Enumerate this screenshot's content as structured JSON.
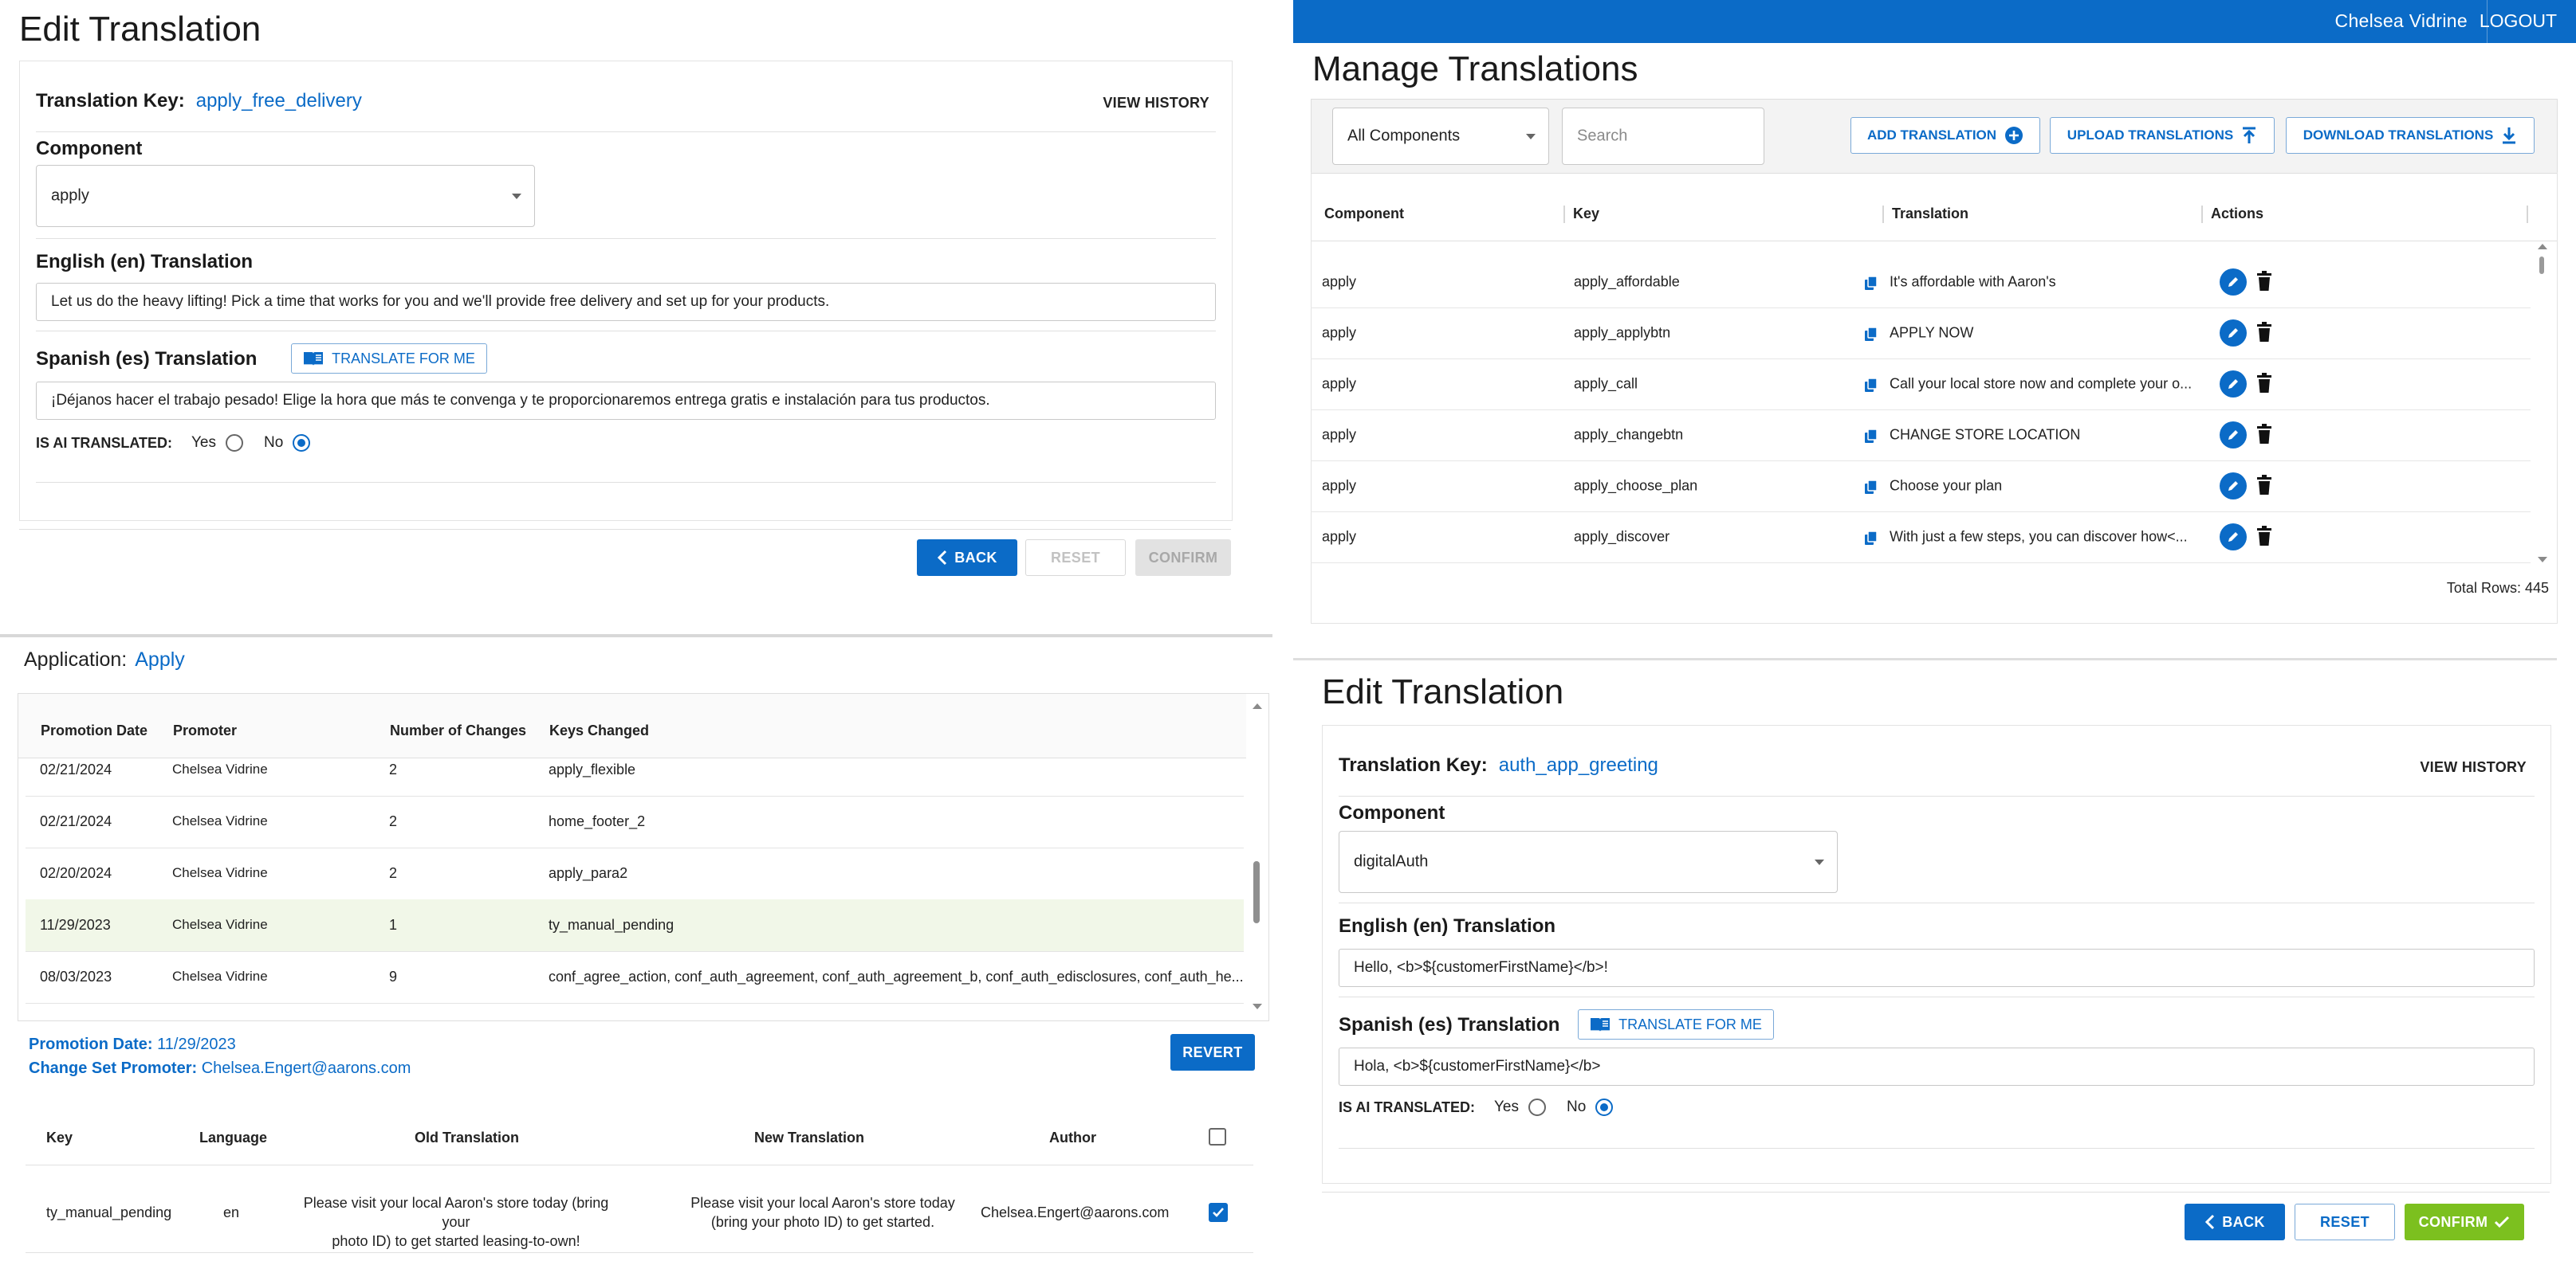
{
  "colors": {
    "accent": "#0b6bc7",
    "confirm_green": "#7cc01f",
    "highlight_row": "#f1f7e8"
  },
  "panel_a": {
    "title": "Edit Translation",
    "key_label": "Translation Key:",
    "key_value": "apply_free_delivery",
    "view_history": "VIEW HISTORY",
    "component_label": "Component",
    "component_value": "apply",
    "english_label": "English (en) Translation",
    "english_value": "Let us do the heavy lifting! Pick a time that works for you and we'll provide free delivery and set up for your products.",
    "spanish_label": "Spanish (es) Translation",
    "translate_btn": "TRANSLATE FOR ME",
    "spanish_value": "¡Déjanos hacer el trabajo pesado! Elige la hora que más te convenga y te proporcionaremos entrega gratis e instalación para tus productos.",
    "ai_label": "IS AI TRANSLATED:",
    "yes": "Yes",
    "no": "No",
    "back": "BACK",
    "reset": "RESET",
    "confirm": "CONFIRM"
  },
  "panel_b": {
    "user": "Chelsea Vidrine",
    "logout": "LOGOUT",
    "title": "Manage Translations",
    "component_filter": "All Components",
    "search_placeholder": "Search",
    "add_btn": "ADD TRANSLATION",
    "upload_btn": "UPLOAD TRANSLATIONS",
    "download_btn": "DOWNLOAD TRANSLATIONS",
    "columns": {
      "component": "Component",
      "key": "Key",
      "translation": "Translation",
      "actions": "Actions"
    },
    "rows": [
      {
        "component": "apply",
        "key": "apply_affordable",
        "translation": "It's affordable with Aaron's"
      },
      {
        "component": "apply",
        "key": "apply_applybtn",
        "translation": "APPLY NOW"
      },
      {
        "component": "apply",
        "key": "apply_call",
        "translation": "Call your local store now and complete your o..."
      },
      {
        "component": "apply",
        "key": "apply_changebtn",
        "translation": "CHANGE STORE LOCATION"
      },
      {
        "component": "apply",
        "key": "apply_choose_plan",
        "translation": "Choose your plan"
      },
      {
        "component": "apply",
        "key": "apply_discover",
        "translation": "With just a few steps, you can discover how<..."
      }
    ],
    "total_rows": "Total Rows: 445"
  },
  "panel_c": {
    "app_label": "Application:",
    "app_value": "Apply",
    "columns": {
      "date": "Promotion Date",
      "promoter": "Promoter",
      "changes": "Number of Changes",
      "keys": "Keys Changed"
    },
    "rows": [
      {
        "date": "02/21/2024",
        "promoter": "Chelsea Vidrine",
        "changes": "2",
        "keys": "apply_flexible"
      },
      {
        "date": "02/21/2024",
        "promoter": "Chelsea Vidrine",
        "changes": "2",
        "keys": "home_footer_2"
      },
      {
        "date": "02/20/2024",
        "promoter": "Chelsea Vidrine",
        "changes": "2",
        "keys": "apply_para2"
      },
      {
        "date": "11/29/2023",
        "promoter": "Chelsea Vidrine",
        "changes": "1",
        "keys": "ty_manual_pending"
      },
      {
        "date": "08/03/2023",
        "promoter": "Chelsea Vidrine",
        "changes": "9",
        "keys": "conf_agree_action, conf_auth_agreement, conf_auth_agreement_b, conf_auth_edisclosures, conf_auth_he..."
      }
    ],
    "detail": {
      "date_label": "Promotion Date:",
      "date_value": "11/29/2023",
      "promoter_label": "Change Set Promoter:",
      "promoter_value": "Chelsea.Engert@aarons.com",
      "revert": "REVERT",
      "columns": {
        "key": "Key",
        "language": "Language",
        "old": "Old Translation",
        "new": "New Translation",
        "author": "Author"
      },
      "row": {
        "key": "ty_manual_pending",
        "language": "en",
        "old_line1": "Please visit your local Aaron's store today (bring your",
        "old_line2": "photo ID) to get started leasing-to-own!",
        "new_line1": "Please visit your local Aaron's store today",
        "new_line2": "(bring your photo ID) to get started.",
        "author": "Chelsea.Engert@aarons.com"
      }
    }
  },
  "panel_d": {
    "title": "Edit Translation",
    "key_label": "Translation Key:",
    "key_value": "auth_app_greeting",
    "view_history": "VIEW HISTORY",
    "component_label": "Component",
    "component_value": "digitalAuth",
    "english_label": "English (en) Translation",
    "english_value": "Hello, <b>${customerFirstName}</b>!",
    "spanish_label": "Spanish (es) Translation",
    "translate_btn": "TRANSLATE FOR ME",
    "spanish_value": "Hola, <b>${customerFirstName}</b>",
    "ai_label": "IS AI TRANSLATED:",
    "yes": "Yes",
    "no": "No",
    "back": "BACK",
    "reset": "RESET",
    "confirm": "CONFIRM"
  }
}
